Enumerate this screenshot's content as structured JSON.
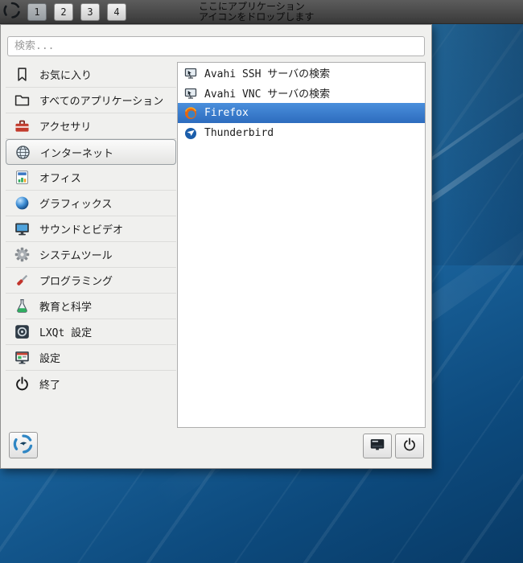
{
  "taskbar": {
    "workspaces": [
      {
        "label": "1",
        "active": true
      },
      {
        "label": "2",
        "active": false
      },
      {
        "label": "3",
        "active": false
      },
      {
        "label": "4",
        "active": false
      }
    ],
    "drop_hint_line1": "ここにアプリケーション",
    "drop_hint_line2": "アイコンをドロップします",
    "menu_button_icon": "lxqt-menu-logo-icon"
  },
  "menu": {
    "search_placeholder": "検索...",
    "categories": [
      {
        "label": "お気に入り",
        "icon": "bookmark-icon",
        "selected": false
      },
      {
        "label": "すべてのアプリケーション",
        "icon": "folder-icon",
        "selected": false
      },
      {
        "label": "アクセサリ",
        "icon": "toolbox-icon",
        "selected": false
      },
      {
        "label": "インターネット",
        "icon": "globe-icon",
        "selected": true
      },
      {
        "label": "オフィス",
        "icon": "office-document-icon",
        "selected": false
      },
      {
        "label": "グラフィックス",
        "icon": "sphere-icon",
        "selected": false
      },
      {
        "label": "サウンドとビデオ",
        "icon": "monitor-media-icon",
        "selected": false
      },
      {
        "label": "システムツール",
        "icon": "gear-icon",
        "selected": false
      },
      {
        "label": "プログラミング",
        "icon": "screwdriver-icon",
        "selected": false
      },
      {
        "label": "教育と科学",
        "icon": "flask-icon",
        "selected": false
      },
      {
        "label": "LXQt 設定",
        "icon": "lxqt-settings-icon",
        "selected": false
      },
      {
        "label": "設定",
        "icon": "settings-monitor-icon",
        "selected": false
      },
      {
        "label": "終了",
        "icon": "power-icon",
        "selected": false
      }
    ],
    "apps": [
      {
        "label": "Avahi SSH サーバの検索",
        "icon": "avahi-network-icon",
        "selected": false
      },
      {
        "label": "Avahi VNC サーバの検索",
        "icon": "avahi-network-icon",
        "selected": false
      },
      {
        "label": "Firefox",
        "icon": "firefox-icon",
        "selected": true
      },
      {
        "label": "Thunderbird",
        "icon": "thunderbird-icon",
        "selected": false
      }
    ],
    "footer": {
      "logo_icon": "lxqt-logo-icon",
      "lock_icon": "lockscreen-icon",
      "power_icon": "power-icon"
    }
  },
  "colors": {
    "selection_blue": "#2d6cbe",
    "panel_gray": "#4a4a4a",
    "menu_background": "#f0f0ee",
    "desktop_blue_top": "#4aa0d5",
    "desktop_blue_bottom": "#083a66"
  }
}
